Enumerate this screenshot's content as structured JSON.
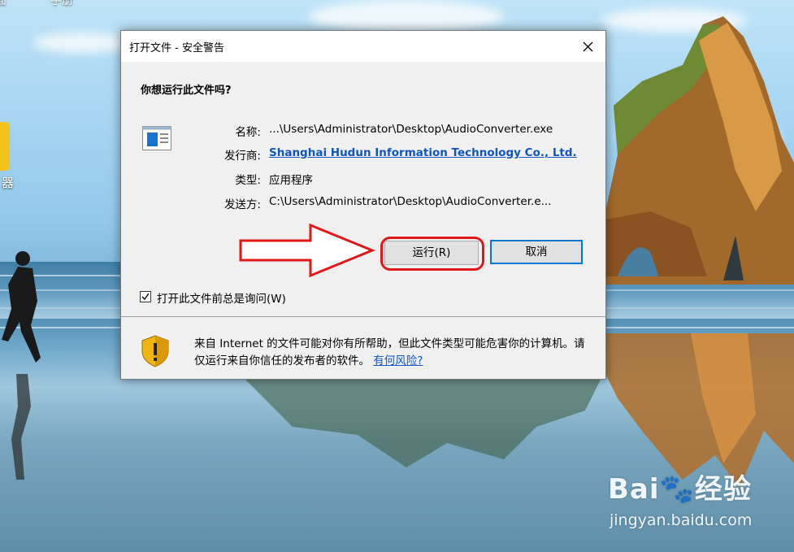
{
  "desktop": {
    "top_label_left": "面",
    "top_label_2": "手册",
    "icon_label": "器"
  },
  "watermark": {
    "brand": "Bai🐾经验",
    "url": "jingyan.baidu.com"
  },
  "dialog": {
    "title": "打开文件 - 安全警告",
    "question": "你想运行此文件吗?",
    "fields": [
      {
        "label": "名称:",
        "value": "...\\Users\\Administrator\\Desktop\\AudioConverter.exe"
      },
      {
        "label": "发行商:",
        "value": "Shanghai Hudun Information Technology Co., Ltd."
      },
      {
        "label": "类型:",
        "value": "应用程序"
      },
      {
        "label": "发送方:",
        "value": "C:\\Users\\Administrator\\Desktop\\AudioConverter.e..."
      }
    ],
    "run_button": "运行(R)",
    "cancel_button": "取消",
    "checkbox_label": "打开此文件前总是询问(W)",
    "checkbox_checked": true,
    "warning_text": "来自 Internet 的文件可能对你有所帮助，但此文件类型可能危害你的计算机。请仅运行来自你信任的发布者的软件。",
    "warning_link": "有何风险?"
  },
  "colors": {
    "link": "#0f56c2",
    "annotation_red": "#e01818",
    "default_button_border": "#0078d7"
  }
}
